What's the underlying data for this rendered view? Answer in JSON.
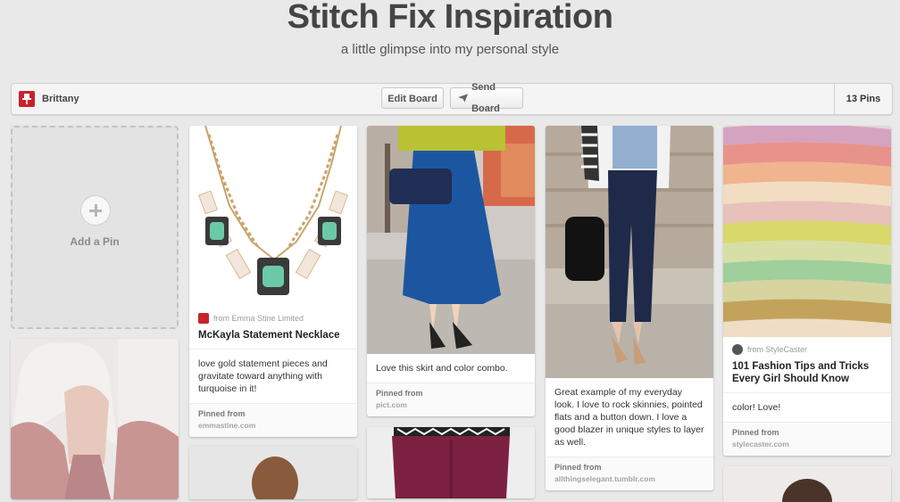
{
  "board": {
    "title": "Stitch Fix Inspiration",
    "description": "a little glimpse into my personal style",
    "owner": "Brittany",
    "edit_label": "Edit Board",
    "send_label": "Send Board",
    "pin_count": "13 Pins"
  },
  "add_pin": {
    "label": "Add a Pin"
  },
  "pins": [
    {
      "source": "from Emma Stine Limited",
      "title": "McKayla Statement Necklace",
      "description": "love gold statement pieces and gravitate toward anything with turquoise in it!",
      "pinned_label": "Pinned from",
      "pinned_domain": "emmastine.com"
    },
    {
      "description": "Love this skirt and color combo.",
      "pinned_label": "Pinned from",
      "pinned_domain": "pict.com"
    },
    {
      "description": "Great example of my everyday look. I love to rock skinnies, pointed flats and a button down. I love a good blazer in unique styles to layer as well.",
      "pinned_label": "Pinned from",
      "pinned_domain": "allthingselegant.tumblr.com"
    },
    {
      "source": "from StyleCaster",
      "title": "101 Fashion Tips and Tricks Every Girl Should Know",
      "description": "color! Love!",
      "pinned_label": "Pinned from",
      "pinned_domain": "stylecaster.com"
    }
  ],
  "icons": {
    "owner": "pinterest-logo-icon",
    "send": "paper-plane-icon",
    "add": "plus-icon"
  },
  "colors": {
    "brand": "#c8232c",
    "background": "#e9e9e9"
  }
}
